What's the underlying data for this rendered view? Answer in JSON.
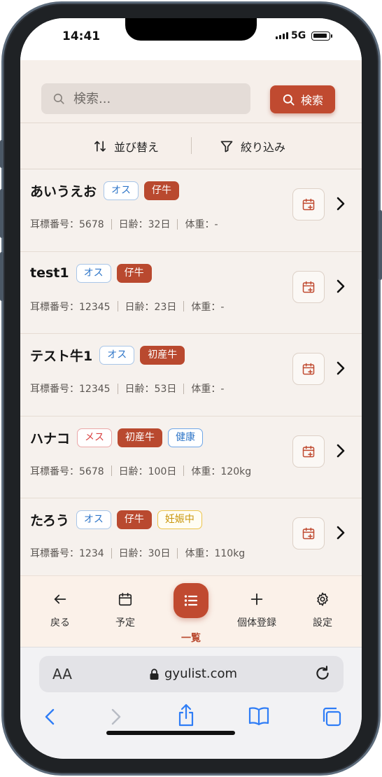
{
  "status": {
    "time": "14:41",
    "network": "5G"
  },
  "search": {
    "placeholder": "検索...",
    "button_label": "検索"
  },
  "toolbar": {
    "sort_label": "並び替え",
    "filter_label": "絞り込み"
  },
  "cattle": [
    {
      "name": "あいうえお",
      "sex": "オス",
      "tags": [
        "仔牛"
      ],
      "ear_tag": "耳標番号：5678",
      "age": "日齢：32日",
      "weight": "体重：-"
    },
    {
      "name": "test1",
      "sex": "オス",
      "tags": [
        "仔牛"
      ],
      "ear_tag": "耳標番号：12345",
      "age": "日齢：23日",
      "weight": "体重：-"
    },
    {
      "name": "テスト牛1",
      "sex": "オス",
      "tags": [
        "初産牛"
      ],
      "ear_tag": "耳標番号：12345",
      "age": "日齢：53日",
      "weight": "体重：-"
    },
    {
      "name": "ハナコ",
      "sex": "メス",
      "tags": [
        "初産牛",
        "健康"
      ],
      "ear_tag": "耳標番号：5678",
      "age": "日齢：100日",
      "weight": "体重：120kg"
    },
    {
      "name": "たろう",
      "sex": "オス",
      "tags": [
        "仔牛",
        "妊娠中"
      ],
      "ear_tag": "耳標番号：1234",
      "age": "日齢：30日",
      "weight": "体重：110kg"
    }
  ],
  "nav": {
    "back": "戻る",
    "schedule": "予定",
    "list": "一覧",
    "register": "個体登録",
    "settings": "設定"
  },
  "browser": {
    "aa": "AA",
    "url": "gyulist.com"
  },
  "colors": {
    "accent": "#c04a30",
    "male": "#2f76c8",
    "female": "#d94343",
    "pregnant": "#c9960b"
  }
}
